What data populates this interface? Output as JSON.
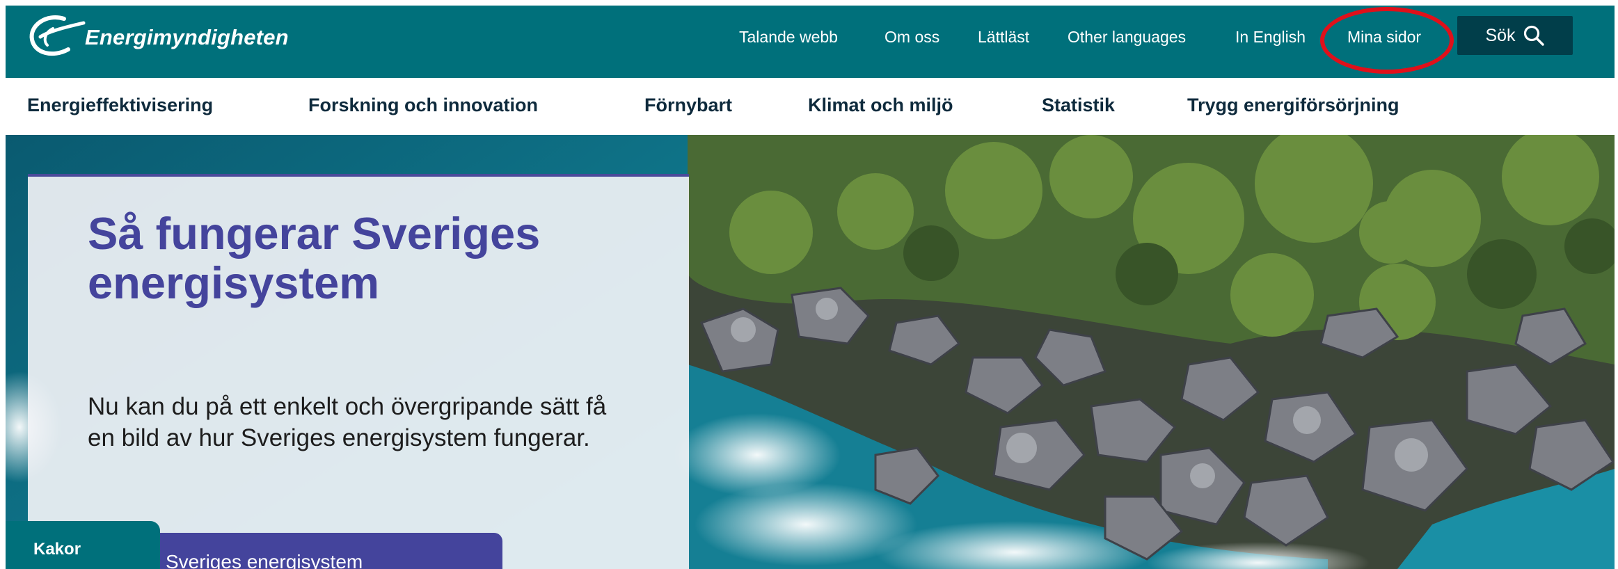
{
  "colors": {
    "brand": "#00707b",
    "dark": "#013e4a",
    "purple": "#44449c",
    "navy": "#0e2a3c",
    "highlight": "#e0101a"
  },
  "header": {
    "logo_text": "Energimyndigheten",
    "utility_links": [
      "Talande webb",
      "Om oss",
      "Lättläst",
      "Other languages",
      "In English",
      "Mina sidor"
    ],
    "search_label": "Sök",
    "search_icon": "search-icon"
  },
  "main_nav": {
    "items": [
      "Energieffektivisering",
      "Forskning och innovation",
      "Förnybart",
      "Klimat och miljö",
      "Statistik",
      "Trygg energiförsörjning"
    ]
  },
  "hero": {
    "title": "Så fungerar Sveriges energisystem",
    "text": "Nu kan du på ett enkelt och övergripande sätt få en bild av hur Sveriges energisystem fungerar.",
    "cta_label": "Sveriges energisystem"
  },
  "cookie_tab_label": "Kakor"
}
